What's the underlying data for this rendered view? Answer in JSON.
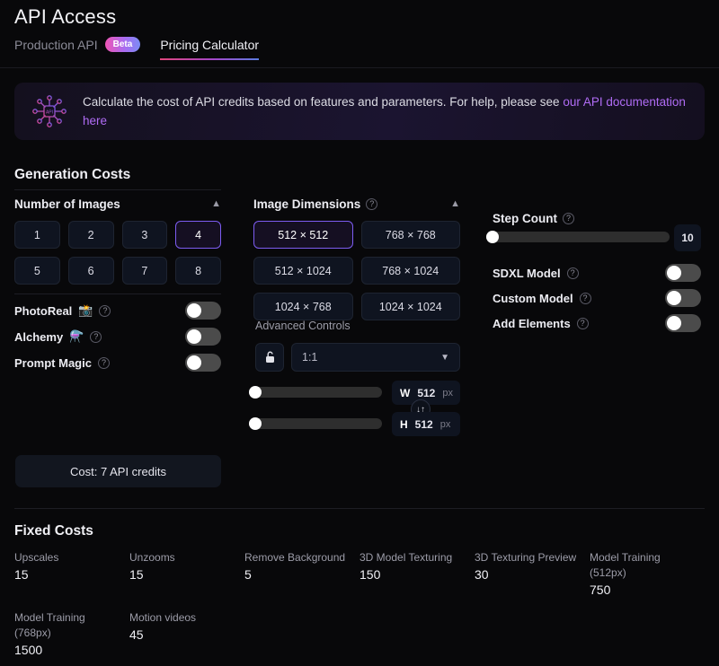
{
  "header": {
    "title": "API Access",
    "tabs": [
      {
        "label": "Production API",
        "badge": "Beta",
        "active": false
      },
      {
        "label": "Pricing Calculator",
        "badge": null,
        "active": true
      }
    ]
  },
  "banner": {
    "icon": "circuit-chip-icon",
    "text_before": "Calculate the cost of API credits based on features and parameters. For help, please see ",
    "link_text": "our API documentation here"
  },
  "generation": {
    "section_title": "Generation Costs",
    "number_of_images": {
      "label": "Number of Images",
      "collapse_icon": "chevron-up-icon",
      "options": [
        "1",
        "2",
        "3",
        "4",
        "5",
        "6",
        "7",
        "8"
      ],
      "selected": "4"
    },
    "feature_toggles": [
      {
        "label": "PhotoReal",
        "emoji": "📸",
        "help": "?",
        "state": "off"
      },
      {
        "label": "Alchemy",
        "emoji": "⚗️",
        "help": "?",
        "state": "off"
      },
      {
        "label": "Prompt Magic",
        "emoji": null,
        "help": "?",
        "state": "off"
      }
    ],
    "cost_summary": "Cost: 7 API credits"
  },
  "dimensions": {
    "label": "Image Dimensions",
    "help": "?",
    "collapse_icon": "chevron-up-icon",
    "options": [
      "512 × 512",
      "768 × 768",
      "512 × 1024",
      "768 × 1024",
      "1024 × 768",
      "1024 × 1024"
    ],
    "selected": "512 × 512",
    "advanced": {
      "label": "Advanced Controls",
      "lock_icon": "unlock-icon",
      "aspect_ratio": "1:1",
      "dropdown_icon": "chevron-down-icon",
      "swap_icon": "↓↑",
      "width": {
        "axis": "W",
        "value": "512",
        "unit": "px",
        "slider_pct": 0
      },
      "height": {
        "axis": "H",
        "value": "512",
        "unit": "px",
        "slider_pct": 0
      }
    }
  },
  "right_panel": {
    "step_count": {
      "label": "Step Count",
      "help": "?",
      "value": "10",
      "slider_pct": 0
    },
    "toggles": [
      {
        "label": "SDXL Model",
        "help": "?",
        "state": "off"
      },
      {
        "label": "Custom Model",
        "help": "?",
        "state": "off"
      },
      {
        "label": "Add Elements",
        "help": "?",
        "state": "off"
      }
    ]
  },
  "fixed_costs": {
    "title": "Fixed Costs",
    "items": [
      {
        "label": "Upscales",
        "value": "15"
      },
      {
        "label": "Unzooms",
        "value": "15"
      },
      {
        "label": "Remove Background",
        "value": "5"
      },
      {
        "label": "3D Model Texturing",
        "value": "150"
      },
      {
        "label": "3D Texturing Preview",
        "value": "30"
      },
      {
        "label": "Model Training (512px)",
        "value": "750"
      },
      {
        "label": "Model Training (768px)",
        "value": "1500"
      },
      {
        "label": "Motion videos",
        "value": "45"
      }
    ]
  },
  "colors": {
    "background": "#08080a",
    "accent_purple": "#7c5cf0",
    "link_purple": "#b06cf5",
    "panel": "#0f1420"
  }
}
